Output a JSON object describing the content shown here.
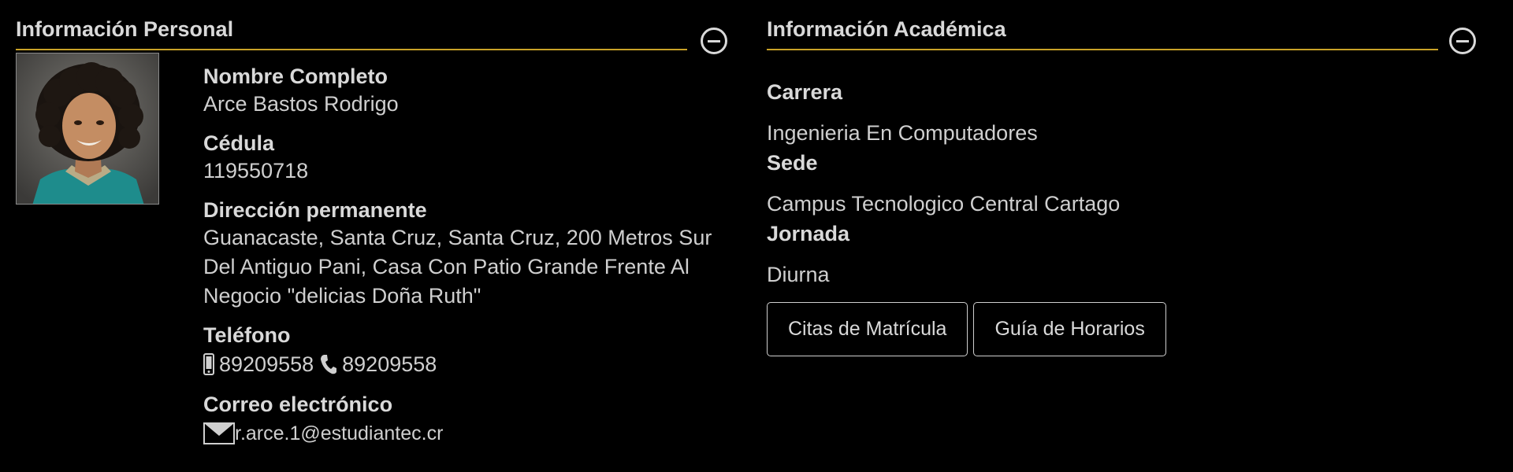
{
  "personal": {
    "title": "Información Personal",
    "name_label": "Nombre Completo",
    "name_value": "Arce Bastos Rodrigo",
    "id_label": "Cédula",
    "id_value": "119550718",
    "address_label": "Dirección permanente",
    "address_value": "Guanacaste, Santa Cruz, Santa Cruz, 200 Metros Sur Del Antiguo Pani, Casa Con Patio Grande Frente Al Negocio \"delicias Doña Ruth\"",
    "phone_label": "Teléfono",
    "mobile_value": "89209558",
    "landline_value": "89209558",
    "email_label": "Correo electrónico",
    "email_value": "r.arce.1@estudiantec.cr"
  },
  "academic": {
    "title": "Información Académica",
    "career_label": "Carrera",
    "career_value": "Ingenieria En Computadores",
    "campus_label": "Sede",
    "campus_value": "Campus Tecnologico Central Cartago",
    "schedule_label": "Jornada",
    "schedule_value": "Diurna",
    "buttons": {
      "enrollment": "Citas de Matrícula",
      "schedule_guide": "Guía de Horarios"
    }
  },
  "colors": {
    "accent_rule": "#c9a227",
    "background": "#000000",
    "text": "#d9d9d9"
  },
  "icons": {
    "collapse": "minus-circle-icon",
    "mobile": "mobile-phone-icon",
    "landline": "phone-handset-icon",
    "email": "envelope-icon"
  }
}
